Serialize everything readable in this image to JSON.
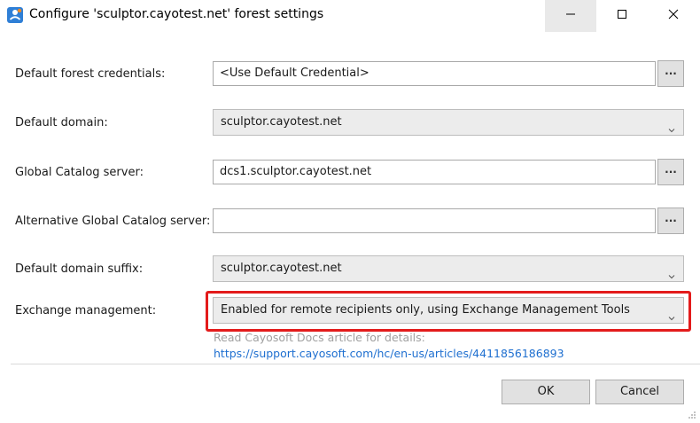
{
  "window": {
    "title": "Configure 'sculptor.cayotest.net' forest settings",
    "icon": "person-network-icon",
    "controls": {
      "minimize": "minimize-icon",
      "maximize": "maximize-icon",
      "close": "close-icon"
    }
  },
  "form": {
    "credentials": {
      "label": "Default forest credentials:",
      "value": "<Use Default Credential>",
      "browse_label": "..."
    },
    "domain": {
      "label": "Default domain:",
      "value": "sculptor.cayotest.net"
    },
    "gc_server": {
      "label": "Global Catalog server:",
      "value": "dcs1.sculptor.cayotest.net",
      "browse_label": "..."
    },
    "alt_gc_server": {
      "label": "Alternative Global Catalog server:",
      "value": "",
      "browse_label": "..."
    },
    "domain_suffix": {
      "label": "Default domain suffix:",
      "value": "sculptor.cayotest.net"
    },
    "exchange": {
      "label": "Exchange management:",
      "value": "Enabled for remote recipients only, using Exchange Management Tools",
      "hint": "Read Cayosoft Docs article for details:",
      "link": "https://support.cayosoft.com/hc/en-us/articles/4411856186893"
    }
  },
  "buttons": {
    "ok": "OK",
    "cancel": "Cancel"
  },
  "colors": {
    "highlight": "#e31b1b",
    "link": "#1e6fd0",
    "hint": "#a0a0a0",
    "icon_blue": "#2f7fd6",
    "icon_orange": "#f08a24"
  }
}
